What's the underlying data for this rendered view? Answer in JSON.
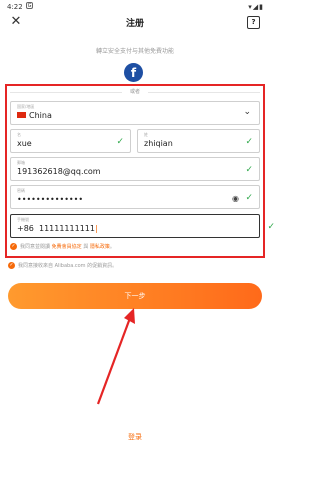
{
  "status_bar": {
    "time": "4:22",
    "indicator": "G",
    "right": "▾◢▮"
  },
  "header": {
    "title": "注册",
    "close_icon": "close-icon",
    "help_icon": "help-icon"
  },
  "subtitle": "轉立安全支付与其他免費功能",
  "social": {
    "facebook_label": "f"
  },
  "divider_text": "或者",
  "form": {
    "country": {
      "label": "国家/地區",
      "value": "China"
    },
    "first_name": {
      "label": "名",
      "value": "xue"
    },
    "last_name": {
      "label": "姓",
      "value": "zhiqian"
    },
    "email": {
      "label": "郵箱",
      "value": "191362618@qq.com"
    },
    "password": {
      "label": "密碼",
      "value": "••••••••••••••"
    },
    "phone": {
      "label": "手機號",
      "prefix": "+86",
      "value": "11111111111"
    }
  },
  "terms": {
    "pre": "我同意並閱讀",
    "agreement": "免費會員協定",
    "mid": "與",
    "privacy": "隱私政策",
    "post": "。"
  },
  "promo": "我同意接收來自 Alibaba.com 的促銷資訊。",
  "buttons": {
    "next": "下一步",
    "login": "登录"
  },
  "colors": {
    "accent": "#f66a0a",
    "annotation": "#e52525",
    "check": "#2ea84a"
  }
}
